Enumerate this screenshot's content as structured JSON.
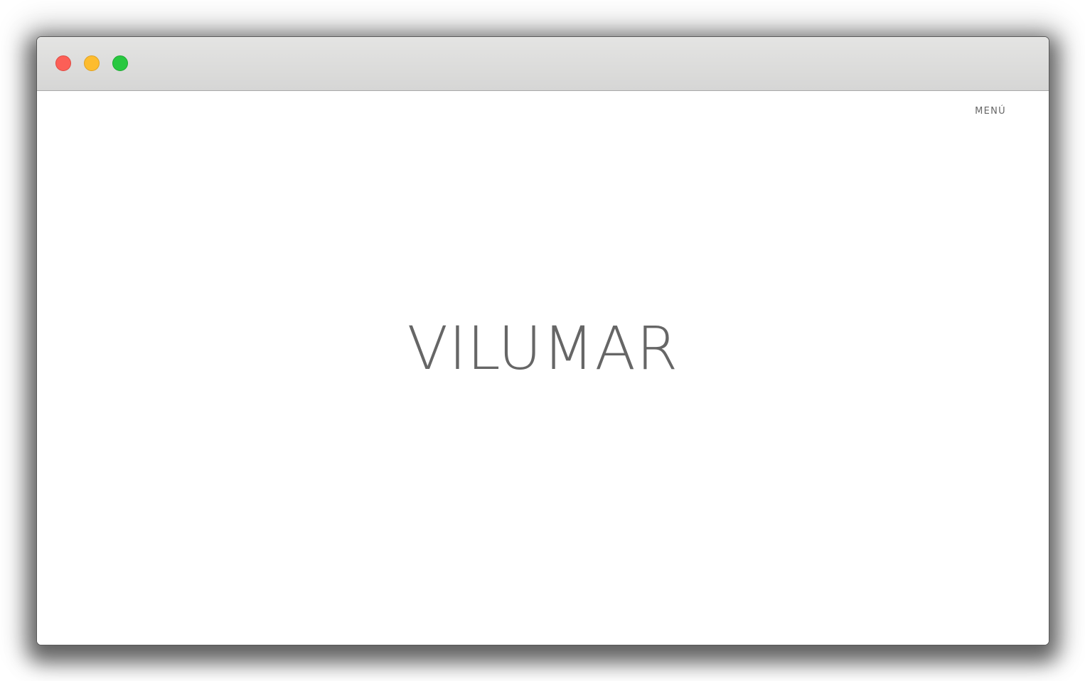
{
  "window": {
    "controls": [
      "close-button",
      "minimize-button",
      "maximize-button"
    ]
  },
  "header": {
    "menu_label": "MENÚ"
  },
  "hero": {
    "brand_title": "VILUMAR"
  },
  "colors": {
    "text": "#666666",
    "close": "#fc5f57",
    "minimize": "#fdbc2e",
    "maximize": "#28c840"
  }
}
